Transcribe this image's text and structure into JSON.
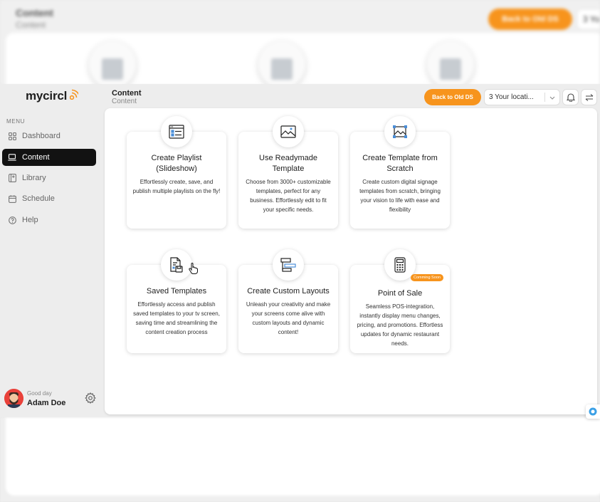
{
  "ghost": {
    "title": "Content",
    "subtitle": "Content",
    "back_label": "Back to Old DS",
    "location": "3 Yo"
  },
  "brand": {
    "logo_text": "mycircl",
    "accent": "#f7941d"
  },
  "sidebar": {
    "menu_label": "MENU",
    "items": [
      {
        "label": "Dashboard",
        "icon": "grid-icon",
        "active": false
      },
      {
        "label": "Content",
        "icon": "laptop-icon",
        "active": true
      },
      {
        "label": "Library",
        "icon": "library-icon",
        "active": false
      },
      {
        "label": "Schedule",
        "icon": "calendar-icon",
        "active": false
      },
      {
        "label": "Help",
        "icon": "help-icon",
        "active": false
      }
    ],
    "user": {
      "greeting": "Good day",
      "name": "Adam Doe"
    }
  },
  "header": {
    "title": "Content",
    "subtitle": "Content",
    "back_label": "Back to Old DS",
    "location": "3 Your locati..."
  },
  "cards": [
    {
      "title": "Create Playlist (Slideshow)",
      "desc": "Effortlessly create, save, and publish multiple playlists on the fly!",
      "icon": "playlist-icon"
    },
    {
      "title": "Use Readymade Template",
      "desc": "Choose from 3000+ customizable templates, perfect for any business. Effortlessly edit to fit your specific needs.",
      "icon": "image-template-icon"
    },
    {
      "title": "Create Template from Scratch",
      "desc": "Create custom digital signage templates from scratch, bringing your vision to life with ease and flexibility",
      "icon": "crop-image-icon"
    },
    {
      "title": "Saved Templates",
      "desc": "Effortlessly access and publish saved templates to your tv screen, saving time and streamlining the content creation process",
      "icon": "saved-document-icon"
    },
    {
      "title": "Create Custom Layouts",
      "desc": "Unleash your creativity and make your screens come alive with custom layouts and dynamic content!",
      "icon": "layout-icon"
    },
    {
      "title": "Point of Sale",
      "desc": "Seamless POS-integration, instantly display menu changes, pricing, and promotions. Effortless updates for dynamic restaurant needs.",
      "icon": "calculator-icon",
      "badge": "Comming Soon"
    }
  ]
}
